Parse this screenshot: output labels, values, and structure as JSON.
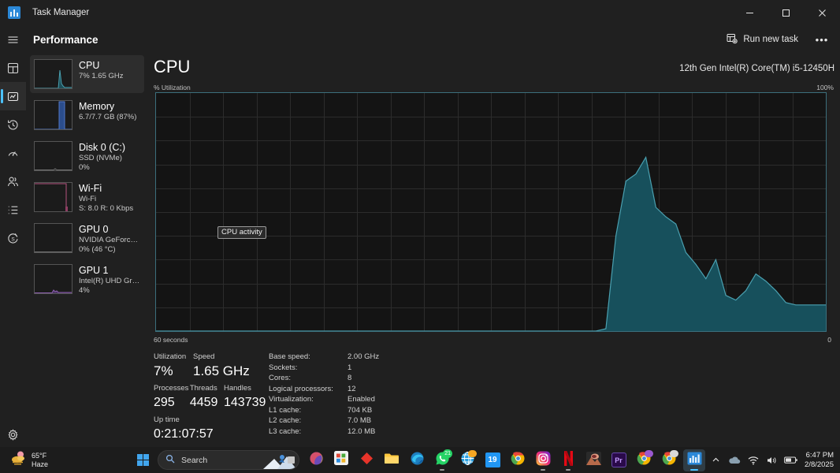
{
  "window": {
    "title": "Task Manager",
    "icon": "task-manager-icon",
    "controls": {
      "minimize": "–",
      "maximize": "❐",
      "close": "✕"
    }
  },
  "rail": {
    "items": [
      {
        "name": "hamburger-menu",
        "icon": "hamburger-icon",
        "selected": false
      },
      {
        "name": "processes",
        "icon": "processes-icon",
        "selected": false
      },
      {
        "name": "performance",
        "icon": "performance-icon",
        "selected": true
      },
      {
        "name": "app-history",
        "icon": "history-icon",
        "selected": false
      },
      {
        "name": "startup-apps",
        "icon": "startup-icon",
        "selected": false
      },
      {
        "name": "users",
        "icon": "users-icon",
        "selected": false
      },
      {
        "name": "details",
        "icon": "details-icon",
        "selected": false
      },
      {
        "name": "services",
        "icon": "services-icon",
        "selected": false
      }
    ],
    "settings_icon": "gear-icon"
  },
  "header": {
    "title": "Performance",
    "run_new_task": "Run new task",
    "run_new_task_icon": "run-task-icon",
    "more_options": "•••"
  },
  "sidebar": {
    "items": [
      {
        "name": "CPU",
        "sub1": "7%  1.65 GHz",
        "sub2": "",
        "selected": true,
        "color": "#3aa3b8"
      },
      {
        "name": "Memory",
        "sub1": "6.7/7.7 GB (87%)",
        "sub2": "",
        "selected": false,
        "color": "#3b63b5"
      },
      {
        "name": "Disk 0 (C:)",
        "sub1": "SSD (NVMe)",
        "sub2": "0%",
        "selected": false,
        "color": "#7a7a7a"
      },
      {
        "name": "Wi-Fi",
        "sub1": "Wi-Fi",
        "sub2": "S: 8.0 R: 0 Kbps",
        "selected": false,
        "color": "#b5537f"
      },
      {
        "name": "GPU 0",
        "sub1": "NVIDIA GeForce GTX...",
        "sub2": "0%  (46 °C)",
        "selected": false,
        "color": "#7a7a7a"
      },
      {
        "name": "GPU 1",
        "sub1": "Intel(R) UHD Graphics",
        "sub2": "4%",
        "selected": false,
        "color": "#8d5fb0"
      }
    ]
  },
  "main": {
    "title": "CPU",
    "model": "12th Gen Intel(R) Core(TM) i5-12450H",
    "axis_top_left": "% Utilization",
    "axis_top_right": "100%",
    "axis_bottom_left": "60 seconds",
    "axis_bottom_right": "0",
    "tooltip": "CPU activity"
  },
  "chart_data": {
    "type": "area",
    "title": "CPU % Utilization",
    "xlabel": "60 seconds",
    "ylabel": "% Utilization",
    "ylim": [
      0,
      100
    ],
    "xlim": [
      60,
      0
    ],
    "grid": true,
    "legend": "none",
    "line_color": "#4aa0b0",
    "fill_color": "#17505c",
    "x_seconds_ago": [
      60,
      59,
      58,
      57,
      56,
      55,
      54,
      53,
      52,
      51,
      50,
      49,
      48,
      47,
      46,
      45,
      44,
      43,
      42,
      41,
      40,
      39,
      38,
      37,
      36,
      35,
      34,
      33,
      32,
      31,
      30,
      29,
      28,
      27,
      26,
      25,
      24,
      23,
      22,
      21,
      20,
      19,
      18,
      17,
      16,
      15,
      14,
      13,
      12,
      11,
      10,
      9,
      8,
      7,
      6,
      5,
      4,
      3,
      2,
      1,
      0
    ],
    "values": [
      0,
      0,
      0,
      0,
      0,
      0,
      0,
      0,
      0,
      0,
      0,
      0,
      0,
      0,
      0,
      0,
      0,
      0,
      0,
      0,
      0,
      0,
      0,
      0,
      0,
      0,
      0,
      0,
      0,
      0,
      0,
      0,
      0,
      0,
      0,
      0,
      0,
      0,
      0,
      0,
      0,
      0,
      0,
      0,
      0,
      1,
      40,
      63,
      66,
      73,
      52,
      48,
      45,
      33,
      28,
      22,
      30,
      15,
      13,
      17,
      24,
      21,
      17,
      12,
      11,
      11,
      11,
      11
    ]
  },
  "stats": {
    "utilization_label": "Utilization",
    "utilization_value": "7%",
    "speed_label": "Speed",
    "speed_value": "1.65 GHz",
    "processes_label": "Processes",
    "processes_value": "295",
    "threads_label": "Threads",
    "threads_value": "4459",
    "handles_label": "Handles",
    "handles_value": "143739",
    "uptime_label": "Up time",
    "uptime_value": "0:21:07:57",
    "specs": [
      {
        "key": "Base speed:",
        "value": "2.00 GHz"
      },
      {
        "key": "Sockets:",
        "value": "1"
      },
      {
        "key": "Cores:",
        "value": "8"
      },
      {
        "key": "Logical processors:",
        "value": "12"
      },
      {
        "key": "Virtualization:",
        "value": "Enabled"
      },
      {
        "key": "L1 cache:",
        "value": "704 KB"
      },
      {
        "key": "L2 cache:",
        "value": "7.0 MB"
      },
      {
        "key": "L3 cache:",
        "value": "12.0 MB"
      }
    ]
  },
  "taskbar": {
    "weather_temp": "65°F",
    "weather_cond": "Haze",
    "weather_icon": "haze-icon",
    "start_label": "Start",
    "search_placeholder": "Search",
    "search_icon": "search-icon",
    "apps": [
      {
        "name": "task-view",
        "icon": "task-view-icon",
        "color": "#b8b8b8",
        "badge": "",
        "running": false
      },
      {
        "name": "copilot",
        "icon": "copilot-icon",
        "color": "#d05ba8",
        "badge": "",
        "running": false
      },
      {
        "name": "microsoft-store",
        "icon": "store-icon",
        "color": "#e8e8e8",
        "badge": "",
        "running": false
      },
      {
        "name": "red-diamond-app",
        "icon": "diamond-icon",
        "color": "#e83f3f",
        "badge": "",
        "running": false
      },
      {
        "name": "file-explorer",
        "icon": "folder-icon",
        "color": "#ffc83d",
        "badge": "",
        "running": false
      },
      {
        "name": "microsoft-edge",
        "icon": "edge-icon",
        "color": "#1e90d0",
        "badge": "",
        "running": false
      },
      {
        "name": "whatsapp",
        "icon": "whatsapp-icon",
        "color": "#25d366",
        "badge": "21",
        "running": true
      },
      {
        "name": "browser-app",
        "icon": "globe-icon",
        "color": "#2aa0e0",
        "badge": "●",
        "running": false
      },
      {
        "name": "calendar",
        "icon": "calendar-icon",
        "color": "#2196f3",
        "badge": "",
        "running": false
      },
      {
        "name": "google-chrome",
        "icon": "chrome-icon",
        "color": "#f4b400",
        "badge": "",
        "running": false
      },
      {
        "name": "instagram",
        "icon": "instagram-icon",
        "color": "#e1306c",
        "badge": "",
        "running": true
      },
      {
        "name": "netflix",
        "icon": "netflix-icon",
        "color": "#e50914",
        "badge": "",
        "running": true
      },
      {
        "name": "photos",
        "icon": "photos-icon",
        "color": "#c06a4a",
        "badge": "",
        "running": false
      },
      {
        "name": "premiere-pro",
        "icon": "premiere-icon",
        "color": "#2a0a4a",
        "badge": "Pr",
        "running": false
      },
      {
        "name": "chrome-profile-a",
        "icon": "chrome-icon",
        "color": "#f4b400",
        "badge": "",
        "running": false
      },
      {
        "name": "chrome-profile-b",
        "icon": "chrome-icon",
        "color": "#f4b400",
        "badge": "",
        "running": false
      },
      {
        "name": "task-manager",
        "icon": "task-manager-icon",
        "color": "#41a5ee",
        "badge": "",
        "running": true
      }
    ],
    "tray": {
      "overflow_icon": "chevron-up-icon",
      "onedrive_icon": "cloud-icon",
      "wifi_icon": "wifi-icon",
      "volume_icon": "speaker-icon",
      "battery_icon": "battery-icon",
      "time": "6:47 PM",
      "date": "2/8/2025"
    }
  }
}
